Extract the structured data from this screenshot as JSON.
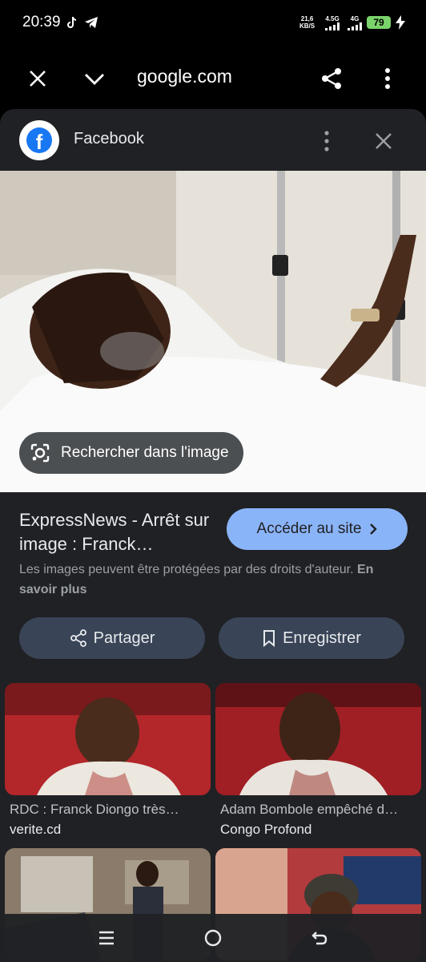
{
  "status_bar": {
    "time": "20:39",
    "net_speed_top": "21,6",
    "net_speed_bottom": "KB/S",
    "signal1_label": "4.5G",
    "signal2_label": "4G",
    "battery": "79"
  },
  "toolbar": {
    "url": "google.com",
    "close_icon": "close-icon",
    "collapse_icon": "chevron-down-icon",
    "share_icon": "share-icon",
    "menu_icon": "more-vert-icon"
  },
  "source": {
    "name": "Facebook",
    "logo_letter": "f"
  },
  "lens": {
    "label": "Rechercher dans l'image"
  },
  "result": {
    "title": "ExpressNews - Arrêt sur image : Franck…",
    "visit_label": "Accéder au site",
    "copyright": "Les images peuvent être protégées par des droits d'auteur.",
    "learn_more": "En savoir plus"
  },
  "actions": {
    "share_label": "Partager",
    "save_label": "Enregistrer"
  },
  "related": [
    {
      "caption": "RDC : Franck Diongo très…",
      "domain": "verite.cd"
    },
    {
      "caption": "Adam Bombole empêché d…",
      "domain": "Congo Profond"
    },
    {
      "caption": "",
      "domain": ""
    },
    {
      "caption": "",
      "domain": ""
    }
  ],
  "colors": {
    "accent": "#8ab4f8",
    "sheet_bg": "#202124",
    "pill_bg": "#394457"
  }
}
